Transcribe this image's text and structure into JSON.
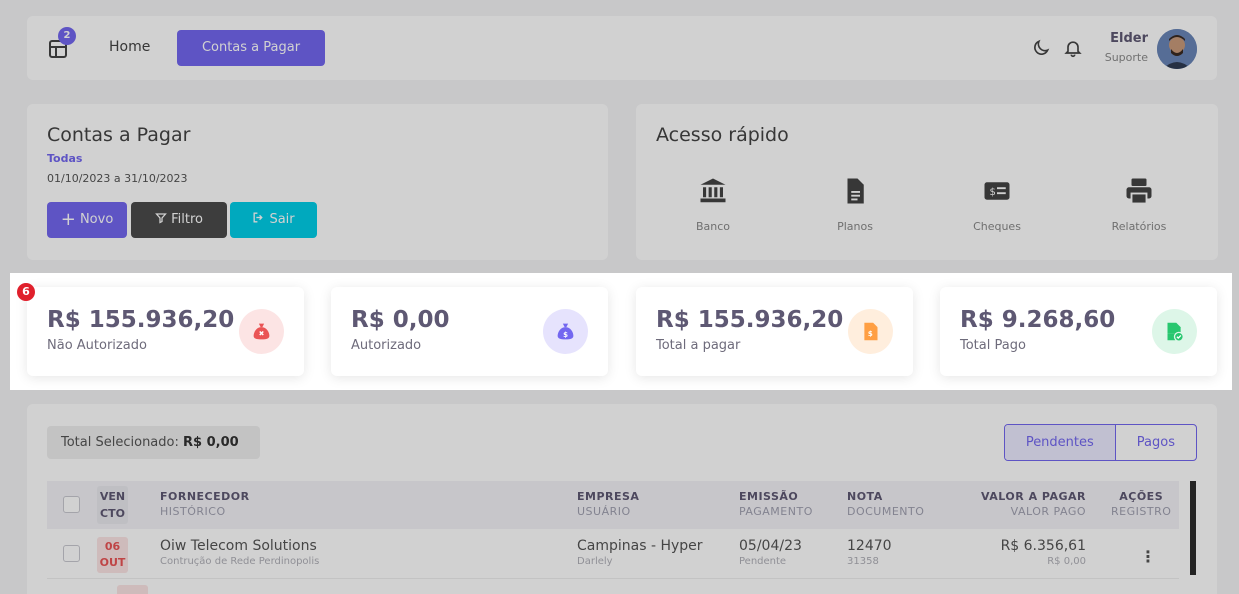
{
  "nav": {
    "badge_count": "2",
    "home_label": "Home",
    "active_label": "Contas a Pagar",
    "user_name": "Elder",
    "user_role": "Suporte"
  },
  "contas_card": {
    "title": "Contas a Pagar",
    "filter": "Todas",
    "period": "01/10/2023 a 31/10/2023",
    "novo_label": "Novo",
    "filtro_label": "Filtro",
    "sair_label": "Sair"
  },
  "acesso_card": {
    "title": "Acesso rápido",
    "items": [
      {
        "label": "Banco",
        "icon": "bank-icon"
      },
      {
        "label": "Planos",
        "icon": "document-icon"
      },
      {
        "label": "Cheques",
        "icon": "check-money-icon"
      },
      {
        "label": "Relatórios",
        "icon": "printer-icon"
      }
    ]
  },
  "marker": "6",
  "stats": [
    {
      "value": "R$ 155.936,20",
      "label": "Não Autorizado",
      "icon": "money-bag-x-icon",
      "color": "#ea5455"
    },
    {
      "value": "R$ 0,00",
      "label": "Autorizado",
      "icon": "money-bag-dollar-icon",
      "color": "#7367f0"
    },
    {
      "value": "R$ 155.936,20",
      "label": "Total a pagar",
      "icon": "invoice-dollar-icon",
      "color": "#ff9f43"
    },
    {
      "value": "R$ 9.268,60",
      "label": "Total Pago",
      "icon": "file-check-icon",
      "color": "#28c76f"
    }
  ],
  "table": {
    "total_label": "Total Selecionado:",
    "total_value": "R$ 0,00",
    "tabs": [
      "Pendentes",
      "Pagos"
    ],
    "headers": {
      "vcto": [
        "VEN",
        "CTO"
      ],
      "fornecedor": "FORNECEDOR",
      "historico": "HISTÓRICO",
      "empresa": "EMPRESA",
      "usuario": "USUÁRIO",
      "emissao": "EMISSÃO",
      "pagamento": "PAGAMENTO",
      "nota": "NOTA",
      "documento": "DOCUMENTO",
      "valor_pagar": "VALOR A PAGAR",
      "valor_pago": "VALOR PAGO",
      "acoes": "AÇÕES",
      "registro": "REGISTRO"
    },
    "rows": [
      {
        "day": "06",
        "month": "OUT",
        "fornecedor": "Oiw Telecom Solutions",
        "historico": "Contrução de Rede Perdinopolis",
        "empresa": "Campinas - Hyper",
        "usuario": "Darlely",
        "emissao": "05/04/23",
        "pagamento": "Pendente",
        "nota": "12470",
        "documento": "31358",
        "valor_pagar": "R$ 6.356,61",
        "valor_pago": "R$ 0,00"
      }
    ]
  }
}
